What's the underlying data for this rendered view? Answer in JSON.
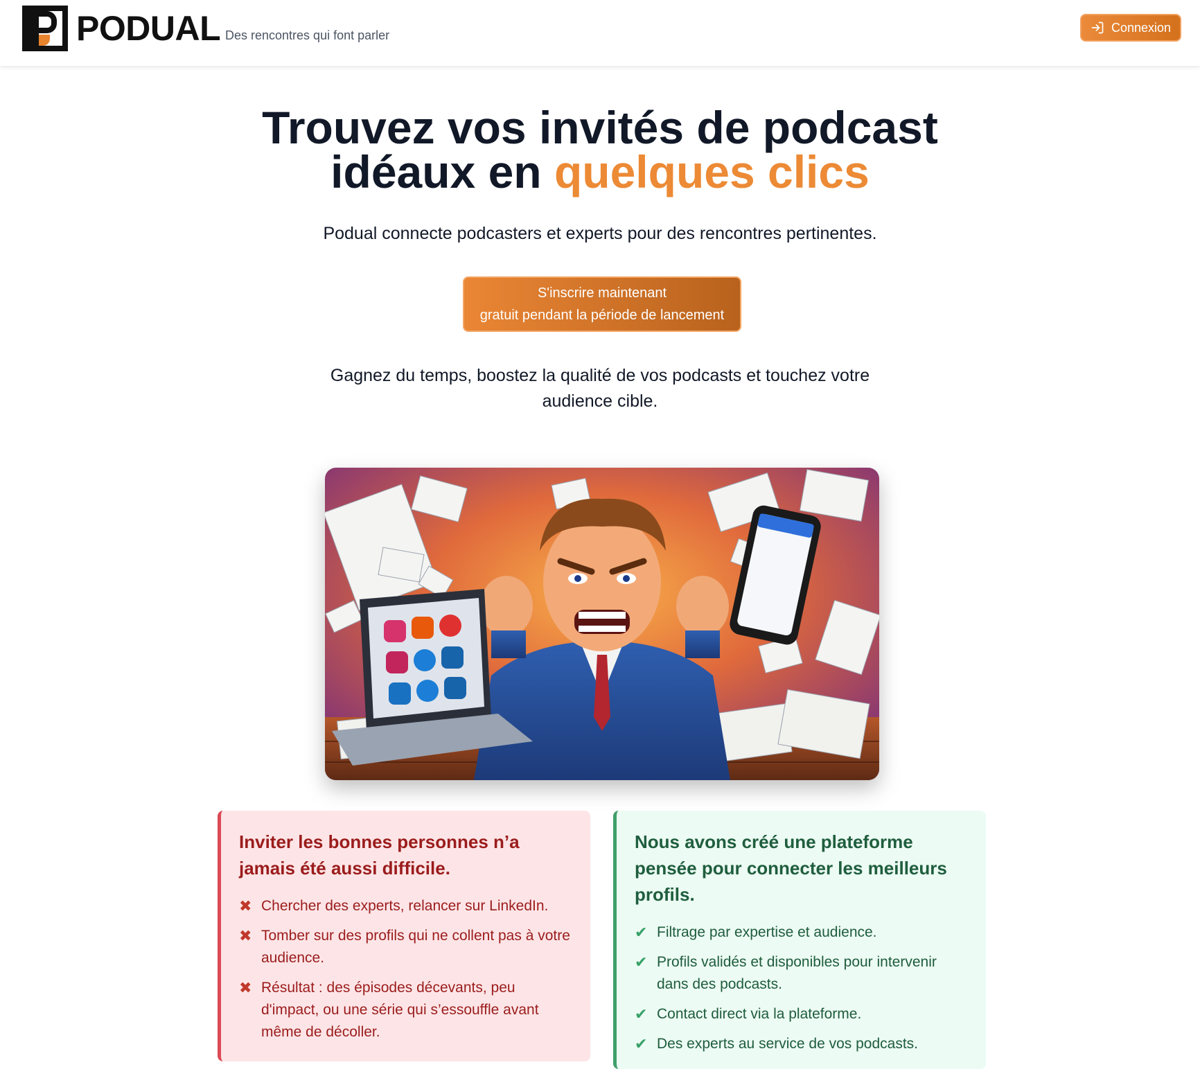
{
  "header": {
    "brand": "PODUAL",
    "tagline": "Des rencontres qui font parler",
    "login_label": "Connexion",
    "login_icon": "sign-in-icon"
  },
  "hero": {
    "title_line1": "Trouvez vos invités de podcast",
    "title_line2_prefix": "idéaux en ",
    "title_line2_accent": "quelques clics",
    "subtitle": "Podual connecte podcasters et experts pour des rencontres pertinentes.",
    "cta_line1": "S'inscrire maintenant",
    "cta_line2": "gratuit pendant la période de lancement",
    "lead": "Gagnez du temps, boostez la qualité de vos podcasts et touchez votre audience cible."
  },
  "colors": {
    "accent": "#ec8a35",
    "problem_bg": "#fde5e7",
    "problem_border": "#dc4a55",
    "solution_bg": "#ecfbf3",
    "solution_border": "#3f9f6a"
  },
  "problem": {
    "title": "Inviter les bonnes personnes n’a jamais été aussi difficile.",
    "mark": "✖",
    "items": [
      "Chercher des experts, relancer sur LinkedIn.",
      "Tomber sur des profils qui ne collent pas à votre audience.",
      "Résultat : des épisodes décevants, peu d'impact, ou une série qui s’essouffle avant même de décoller."
    ]
  },
  "solution": {
    "title": "Nous avons créé une plateforme pensée pour connecter les meilleurs profils.",
    "mark": "✔",
    "items": [
      "Filtrage par expertise et audience.",
      "Profils validés et disponibles pour intervenir dans des podcasts.",
      "Contact direct via la plateforme.",
      "Des experts au service de vos podcasts."
    ]
  }
}
